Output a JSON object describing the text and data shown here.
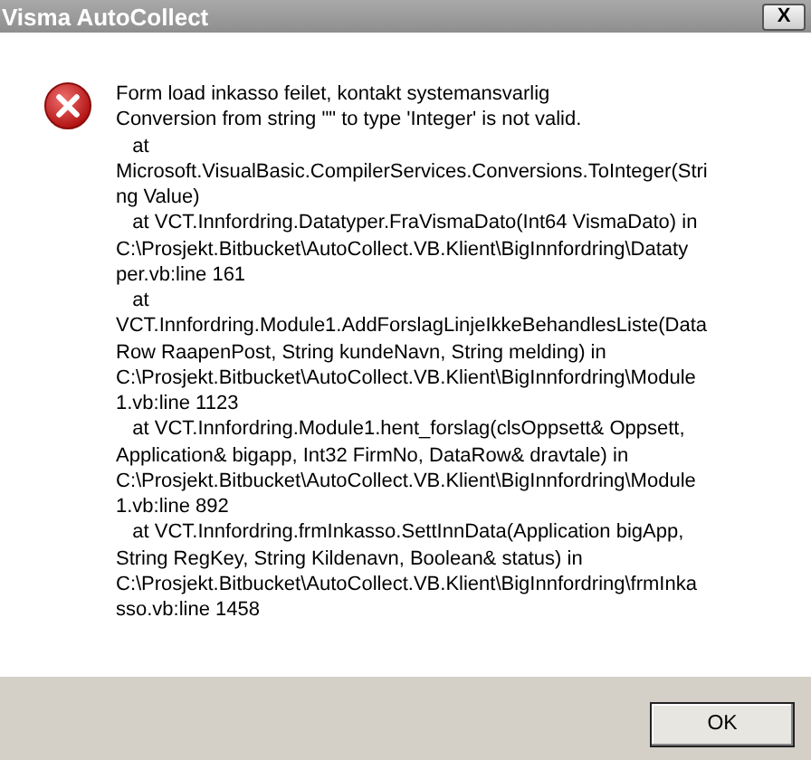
{
  "window": {
    "title": "Visma AutoCollect",
    "close": "X"
  },
  "dialog": {
    "kind": "error",
    "message_lines": [
      "Form load inkasso feilet, kontakt systemansvarlig",
      "Conversion from string \"\" to type 'Integer' is not valid.",
      "   at",
      "Microsoft.VisualBasic.CompilerServices.Conversions.ToInteger(Stri",
      "ng Value)",
      "   at VCT.Innfordring.Datatyper.FraVismaDato(Int64 VismaDato) in",
      "C:\\Prosjekt.Bitbucket\\AutoCollect.VB.Klient\\BigInnfordring\\Dataty",
      "per.vb:line 161",
      "   at",
      "VCT.Innfordring.Module1.AddForslagLinjeIkkeBehandlesListe(Data",
      "Row RaapenPost, String kundeNavn, String melding) in",
      "C:\\Prosjekt.Bitbucket\\AutoCollect.VB.Klient\\BigInnfordring\\Module",
      "1.vb:line 1123",
      "   at VCT.Innfordring.Module1.hent_forslag(clsOppsett& Oppsett,",
      "Application& bigapp, Int32 FirmNo, DataRow& dravtale) in",
      "C:\\Prosjekt.Bitbucket\\AutoCollect.VB.Klient\\BigInnfordring\\Module",
      "1.vb:line 892",
      "   at VCT.Innfordring.frmInkasso.SettInnData(Application bigApp,",
      "String RegKey, String Kildenavn, Boolean& status) in",
      "C:\\Prosjekt.Bitbucket\\AutoCollect.VB.Klient\\BigInnfordring\\frmInka",
      "sso.vb:line 1458"
    ]
  },
  "buttons": [
    "OK"
  ]
}
